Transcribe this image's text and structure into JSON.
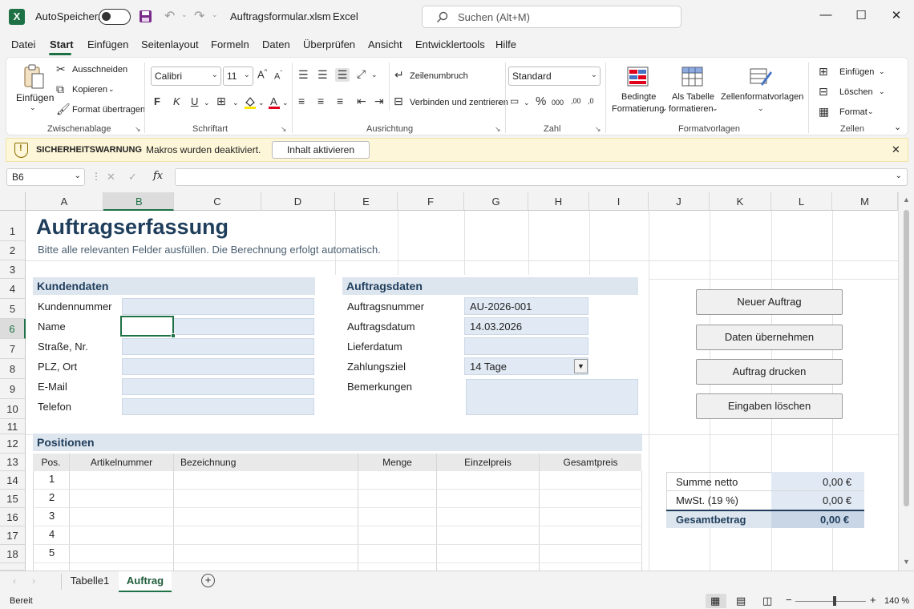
{
  "titlebar": {
    "app_icon": "X",
    "autosave_label": "AutoSpeichern",
    "filename": "Auftragsformular.xlsm",
    "app_name": "Excel",
    "search_placeholder": "Suchen (Alt+M)"
  },
  "ribbon_tabs": [
    "Datei",
    "Start",
    "Einfügen",
    "Seitenlayout",
    "Formeln",
    "Daten",
    "Überprüfen",
    "Ansicht",
    "Entwicklertools",
    "Hilfe"
  ],
  "active_tab": "Start",
  "ribbon": {
    "clipboard": {
      "paste": "Einfügen",
      "cut": "Ausschneiden",
      "copy": "Kopieren",
      "format_painter": "Format übertragen",
      "group": "Zwischenablage"
    },
    "font": {
      "name": "Calibri",
      "size": "11",
      "bold": "F",
      "italic": "K",
      "underline": "U",
      "grow": "A",
      "shrink": "A",
      "group": "Schriftart"
    },
    "alignment": {
      "wrap": "Zeilenumbruch",
      "merge": "Verbinden und zentrieren",
      "group": "Ausrichtung"
    },
    "number": {
      "format": "Standard",
      "percent": "%",
      "thousands": "000",
      "dec_inc": ",00",
      "dec_dec": ",0",
      "group": "Zahl"
    },
    "styles": {
      "conditional": "Bedingte",
      "conditional2": "Formatierung",
      "table": "Als Tabelle",
      "table2": "formatieren",
      "cellstyles": "Zellenformatvorlagen",
      "group": "Formatvorlagen"
    },
    "cells": {
      "insert": "Einfügen",
      "delete": "Löschen",
      "format": "Format",
      "group": "Zellen"
    }
  },
  "warning": {
    "title": "SICHERHEITSWARNUNG",
    "message": "Makros wurden deaktiviert.",
    "button": "Inhalt aktivieren"
  },
  "formula_bar": {
    "name_box": "B6",
    "fx": "fx",
    "value": ""
  },
  "columns": [
    "A",
    "B",
    "C",
    "D",
    "E",
    "F",
    "G",
    "H",
    "I",
    "J",
    "K",
    "L",
    "M"
  ],
  "selected_column": "B",
  "rows": [
    "1",
    "2",
    "3",
    "4",
    "5",
    "6",
    "7",
    "8",
    "9",
    "10",
    "11",
    "12",
    "13",
    "14",
    "15",
    "16",
    "17",
    "18"
  ],
  "selected_row": "6",
  "sheet": {
    "title": "Auftragserfassung",
    "subtitle": "Bitte alle relevanten Felder ausfüllen. Die Berechnung erfolgt automatisch.",
    "customer": {
      "header": "Kundendaten",
      "fields": [
        "Kundennummer",
        "Name",
        "Straße, Nr.",
        "PLZ, Ort",
        "E-Mail",
        "Telefon"
      ]
    },
    "order": {
      "header": "Auftragsdaten",
      "labels": [
        "Auftragsnummer",
        "Auftragsdatum",
        "Lieferdatum",
        "Zahlungsziel",
        "Bemerkungen"
      ],
      "order_number": "AU-2026-001",
      "order_date": "14.03.2026",
      "delivery_date": "",
      "payment_terms": "14 Tage",
      "remarks": ""
    },
    "buttons": [
      "Neuer Auftrag",
      "Daten übernehmen",
      "Auftrag drucken",
      "Eingaben löschen"
    ],
    "positions": {
      "header": "Positionen",
      "columns": [
        "Pos.",
        "Artikelnummer",
        "Bezeichnung",
        "Menge",
        "Einzelpreis",
        "Gesamtpreis"
      ],
      "rows": [
        "1",
        "2",
        "3",
        "4",
        "5"
      ]
    },
    "totals": {
      "net_label": "Summe netto",
      "net_value": "0,00 €",
      "vat_label": "MwSt. (19 %)",
      "vat_value": "0,00 €",
      "total_label": "Gesamtbetrag",
      "total_value": "0,00 €"
    }
  },
  "sheet_tabs": [
    "Tabelle1",
    "Auftrag"
  ],
  "active_sheet": "Auftrag",
  "status": {
    "ready": "Bereit",
    "zoom": "140 %"
  }
}
